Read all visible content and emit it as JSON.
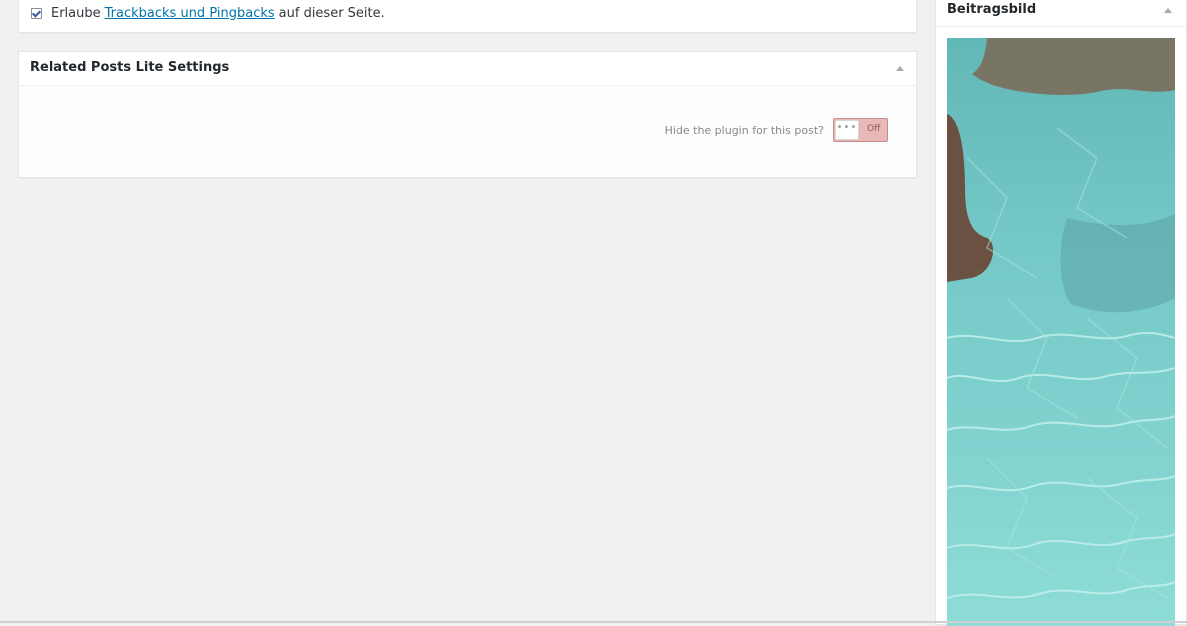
{
  "discussion": {
    "text_before": "Erlaube",
    "link_text": "Trackbacks und Pingbacks",
    "text_after": "auf dieser Seite.",
    "checked": true
  },
  "related_posts": {
    "title": "Related Posts Lite Settings",
    "hide_label": "Hide the plugin for this post?",
    "switch_text": "Off",
    "switch_knob": "•••"
  },
  "featured_image": {
    "title": "Beitragsbild"
  },
  "icons": {
    "collapse": "triangle-up-icon",
    "checkbox": "checkmark-icon"
  },
  "colors": {
    "background": "#f1f1f1",
    "link": "#0073aa",
    "switch_off": "#e9b8b8"
  }
}
